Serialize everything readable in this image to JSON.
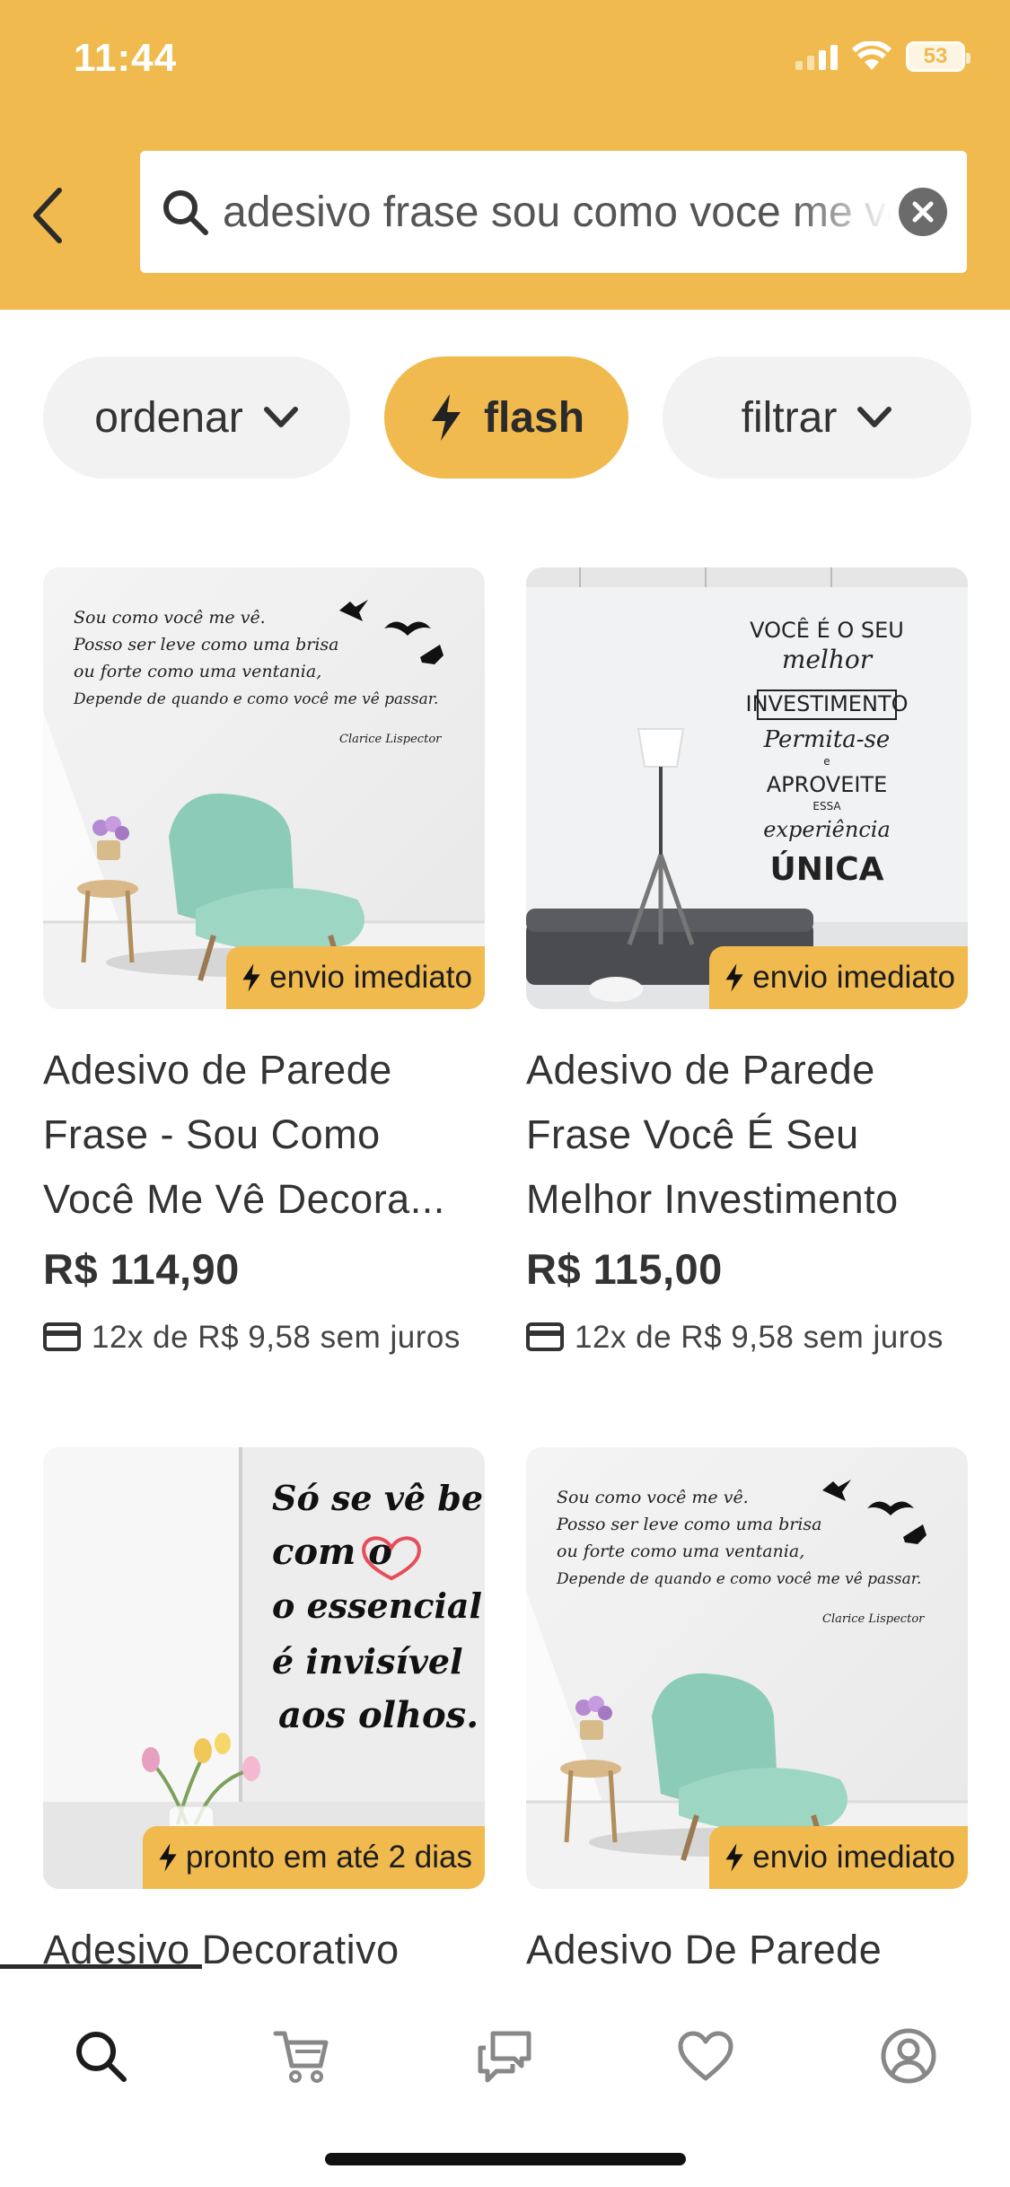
{
  "status": {
    "time": "11:44",
    "battery": "53"
  },
  "search": {
    "query": "adesivo frase sou como voce me ve"
  },
  "chips": {
    "ordenar": "ordenar",
    "flash": "flash",
    "filtrar": "filtrar"
  },
  "products": [
    {
      "image_text": [
        "Sou como você me vê.",
        "Posso ser leve como uma brisa",
        "ou forte como uma ventania,",
        "Depende de quando e como você me vê passar.",
        "Clarice Lispector"
      ],
      "badge": "envio imediato",
      "title_line1": "Adesivo de Parede",
      "title_line2": "Frase - Sou Como",
      "title_line3": "Você Me Vê Decora...",
      "price": "R$ 114,90",
      "installment": "12x de R$ 9,58 sem juros"
    },
    {
      "image_text": [
        "VOCÊ É O SEU",
        "melhor",
        "INVESTIMENTO",
        "Permita-se",
        "e",
        "APROVEITE",
        "ESSA",
        "experiência",
        "ÚNICA"
      ],
      "badge": "envio imediato",
      "title_line1": "Adesivo de Parede",
      "title_line2": "Frase Você É Seu",
      "title_line3": "Melhor Investimento",
      "price": "R$ 115,00",
      "installment": "12x de R$ 9,58 sem juros"
    },
    {
      "image_text": [
        "Só se vê bem",
        "com o",
        "o essencial",
        "é invisível",
        "aos olhos."
      ],
      "badge": "pronto em até 2 dias",
      "title_line1": "Adesivo Decorativo"
    },
    {
      "image_text": [
        "Sou como você me vê.",
        "Posso ser leve como uma brisa",
        "ou forte como uma ventania,",
        "Depende de quando e como você me vê passar.",
        "Clarice Lispector"
      ],
      "badge": "envio imediato",
      "title_line1": "Adesivo De Parede"
    }
  ],
  "tabbar": [
    "search-icon",
    "cart-icon",
    "chat-icon",
    "heart-icon",
    "profile-icon"
  ],
  "colors": {
    "accent": "#F0BA4E",
    "chip_bg": "#F2F2F2",
    "text": "#333333"
  }
}
